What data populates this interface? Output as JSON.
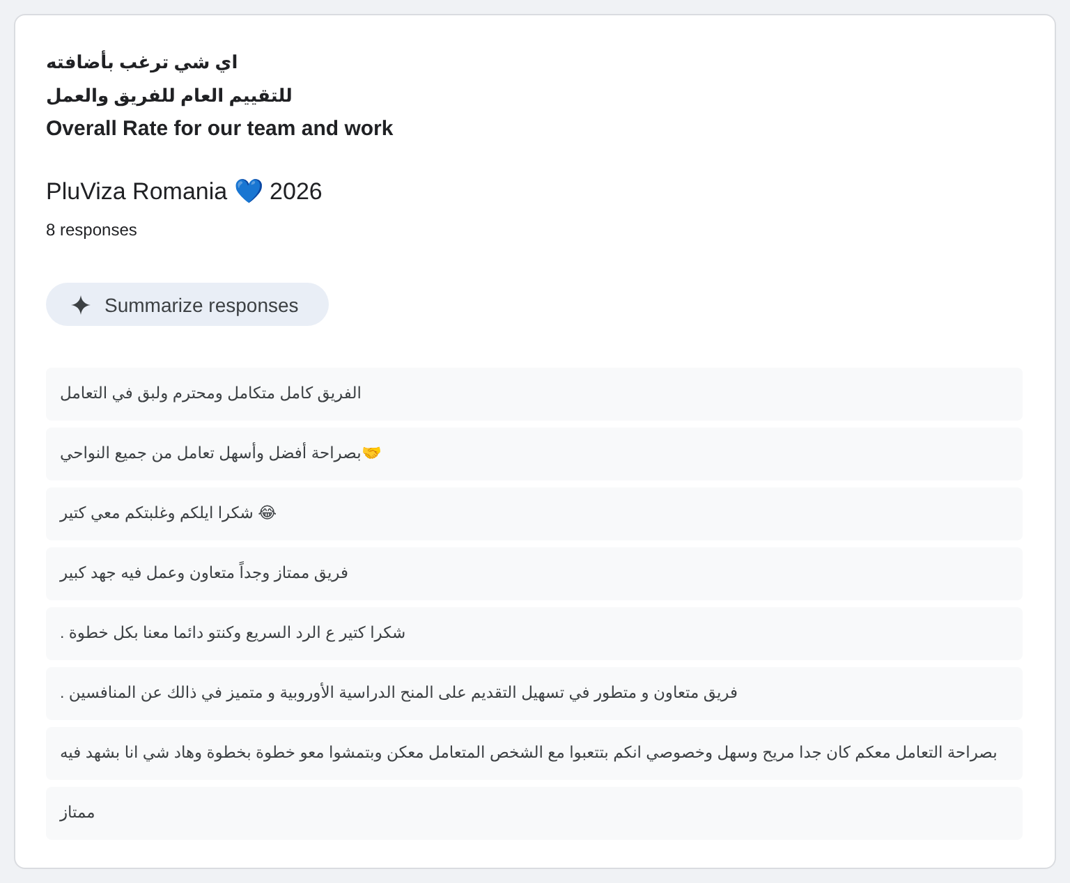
{
  "question": {
    "title_lines": [
      "اي شي ترغب بأضافته",
      "للتقييم العام للفريق والعمل",
      "Overall Rate for our team and work"
    ],
    "description": "PluViza Romania 💙 2026",
    "response_count": "8 responses"
  },
  "summarize_button": {
    "label": "Summarize responses"
  },
  "responses": [
    {
      "text": "الفريق كامل متكامل ومحترم ولبق في التعامل"
    },
    {
      "text": "🤝بصراحة أفضل وأسهل تعامل من جميع النواحي"
    },
    {
      "text": "😂 شكرا ايلكم وغلبتكم معي كتير"
    },
    {
      "text": "فريق ممتاز وجداً متعاون وعمل فيه جهد كبير"
    },
    {
      "text": "شكرا كتير ع الرد السريع وكنتو دائما معنا بكل خطوة ."
    },
    {
      "text": "فريق متعاون و متطور في تسهيل التقديم على المنح الدراسية الأوروبية و متميز في ذالك عن المنافسين ."
    },
    {
      "text": "بصراحة التعامل معكم كان جدا مريح وسهل وخصوصي انكم بتتعبوا مع الشخص المتعامل معكن وبتمشوا معو خطوة بخطوة وهاد شي انا بشهد فيه"
    },
    {
      "text": "ممتاز"
    }
  ]
}
